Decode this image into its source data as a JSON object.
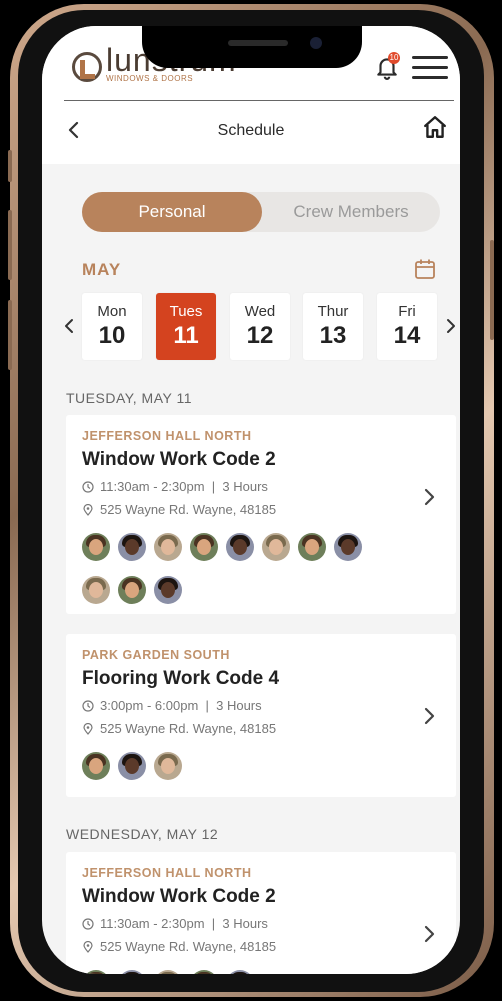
{
  "header": {
    "logo_text": "lunstrum",
    "logo_sub": "WINDOWS & DOORS",
    "notification_count": "10",
    "title": "Schedule"
  },
  "toggle": {
    "active": "Personal",
    "inactive": "Crew Members"
  },
  "calendar": {
    "month": "MAY",
    "days": [
      {
        "name": "Mon",
        "num": "10"
      },
      {
        "name": "Tues",
        "num": "11"
      },
      {
        "name": "Wed",
        "num": "12"
      },
      {
        "name": "Thur",
        "num": "13"
      },
      {
        "name": "Fri",
        "num": "14"
      }
    ],
    "selected_index": 1
  },
  "sections": [
    {
      "heading": "TUESDAY, MAY 11"
    },
    {
      "heading": "WEDNESDAY, MAY 12"
    }
  ],
  "jobs": [
    {
      "site": "JEFFERSON HALL NORTH",
      "title": "Window Work Code 2",
      "time": "11:30am - 2:30pm",
      "duration": "3 Hours",
      "address": "525 Wayne Rd. Wayne, 48185",
      "avatar_count": 11
    },
    {
      "site": "PARK GARDEN SOUTH",
      "title": "Flooring Work Code 4",
      "time": "3:00pm - 6:00pm",
      "duration": "3 Hours",
      "address": "525 Wayne Rd. Wayne, 48185",
      "avatar_count": 3
    },
    {
      "site": "JEFFERSON HALL NORTH",
      "title": "Window Work Code 2",
      "time": "11:30am - 2:30pm",
      "duration": "3 Hours",
      "address": "525 Wayne Rd. Wayne, 48185",
      "avatar_count": 5
    }
  ],
  "colors": {
    "accent": "#b8835c",
    "selected": "#d4431f",
    "badge": "#e04b2c"
  },
  "icons": [
    "bell-icon",
    "menu-icon",
    "back-icon",
    "home-icon",
    "calendar-icon",
    "clock-icon",
    "location-icon",
    "chevron-right-icon"
  ]
}
